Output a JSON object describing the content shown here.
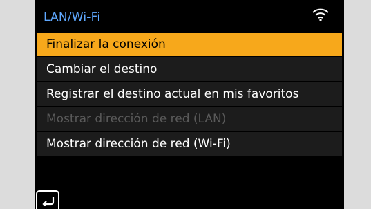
{
  "header": {
    "title": "LAN/Wi-Fi",
    "status_icon": "wifi-icon"
  },
  "menu": {
    "items": [
      {
        "label": "Finalizar la conexión",
        "state": "selected"
      },
      {
        "label": "Cambiar el destino",
        "state": "normal"
      },
      {
        "label": "Registrar el destino actual en mis favoritos",
        "state": "normal"
      },
      {
        "label": "Mostrar dirección de red (LAN)",
        "state": "disabled"
      },
      {
        "label": "Mostrar dirección de red (Wi-Fi)",
        "state": "normal"
      }
    ]
  },
  "footer": {
    "back_icon": "back-arrow-icon"
  },
  "colors": {
    "accent": "#f7a81b",
    "title": "#5fa8ff",
    "background": "#000000",
    "disabled_text": "#5a5a5a"
  }
}
